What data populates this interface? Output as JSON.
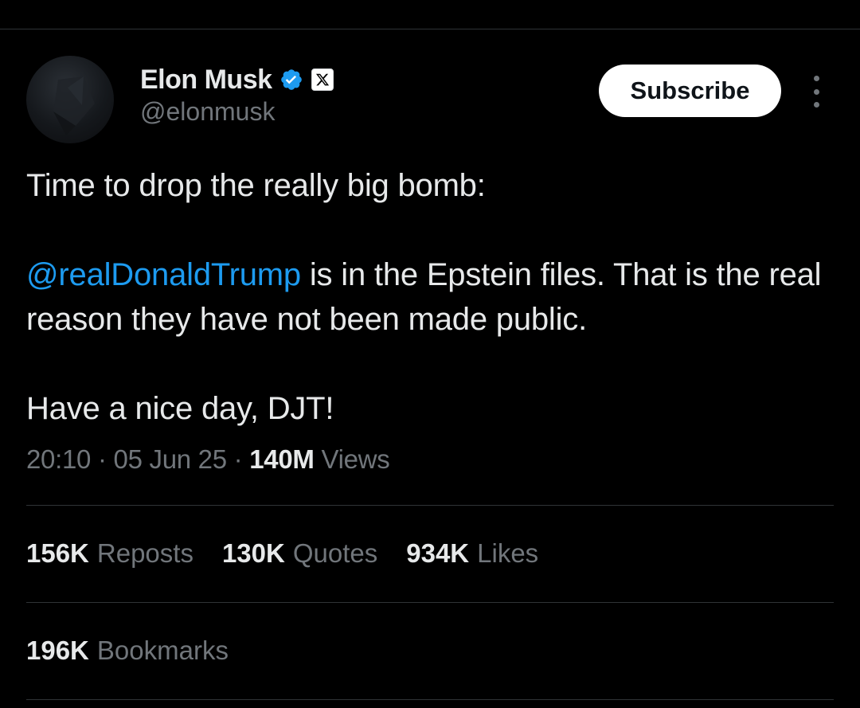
{
  "author": {
    "display_name": "Elon Musk",
    "handle": "@elonmusk",
    "avatar_icon": "avatar-image",
    "verified_icon": "verified-badge-icon",
    "affiliation_icon": "x-logo-icon"
  },
  "actions": {
    "subscribe_label": "Subscribe",
    "more_icon": "more-vertical-icon"
  },
  "tweet": {
    "line1": "Time to drop the really big bomb:",
    "mention": "@realDonaldTrump",
    "line2_rest": " is in the Epstein files. That is the real reason they have not been made public.",
    "line3": "Have a nice day, DJT!"
  },
  "meta": {
    "time": "20:10",
    "separator": " · ",
    "date": "05 Jun 25",
    "views_count": "140M",
    "views_label": "Views"
  },
  "stats": [
    {
      "count": "156K",
      "label": "Reposts"
    },
    {
      "count": "130K",
      "label": "Quotes"
    },
    {
      "count": "934K",
      "label": "Likes"
    }
  ],
  "bookmarks": {
    "count": "196K",
    "label": "Bookmarks"
  },
  "colors": {
    "background": "#000000",
    "text": "#e7e9ea",
    "secondary": "#71767b",
    "link": "#1d9bf0",
    "divider": "#2f3336"
  }
}
